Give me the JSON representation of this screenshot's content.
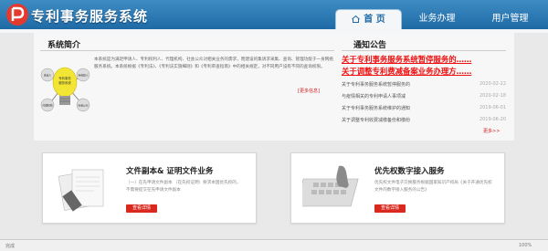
{
  "header": {
    "title": "专利事务服务系统",
    "nav": [
      "首 页",
      "业务办理",
      "用户管理"
    ]
  },
  "intro": {
    "heading": "系统简介",
    "text": "本系统是为满足申请人、专利权利人、代理机构、社会公众对相关业务的需求，而建设的集请求采集、查询、管理功能于一身网络服务系统。本系统根据《专利法》、《专利法实施细则》和《专利审查指南》中的相关规定，对不同用户设有不同的查询权限。",
    "detail_link": "[更多信息]",
    "diagram": {
      "center": "专利事务服务系统",
      "left_top": "申请人",
      "left_bottom": "代理机构",
      "right_top": "专利权人",
      "right_bottom": "社会公众"
    }
  },
  "notice": {
    "heading": "通知公告",
    "headlines": [
      "关于专利事务服务系统暂停服务的……",
      "关于调整专利费减备案业务办理方……"
    ],
    "items": [
      {
        "title": "关于专利事务服务系统暂停服务的",
        "date": "2020-02-22"
      },
      {
        "title": "与疫情相关的专利申请人事项减",
        "date": "2020-02-18"
      },
      {
        "title": "关于专利事务服务系统维护的通知",
        "date": "2019-06-01"
      },
      {
        "title": "关于调整专利收费减缴备份和缴纷",
        "date": "2019-06-20"
      }
    ],
    "more": "更多>>"
  },
  "cards": [
    {
      "title": "文件副本& 证明文件业务",
      "desc": "（一）在先申请文件副本 （在先权证明）要求本国优先权的，不需要提交在先申请文件副本",
      "button": "查看详情"
    },
    {
      "title": "优先权数字接入服务",
      "desc": "优先权文件电子交换服务根据国家知识产权局《关于开通优先权文件的数字接入服务的公告》",
      "button": "查看详情"
    }
  ],
  "status": [
    "完成",
    "100%"
  ],
  "colors": {
    "header": "#1f6aa6",
    "accent_red": "#e11",
    "button_red": "#d9281e"
  }
}
